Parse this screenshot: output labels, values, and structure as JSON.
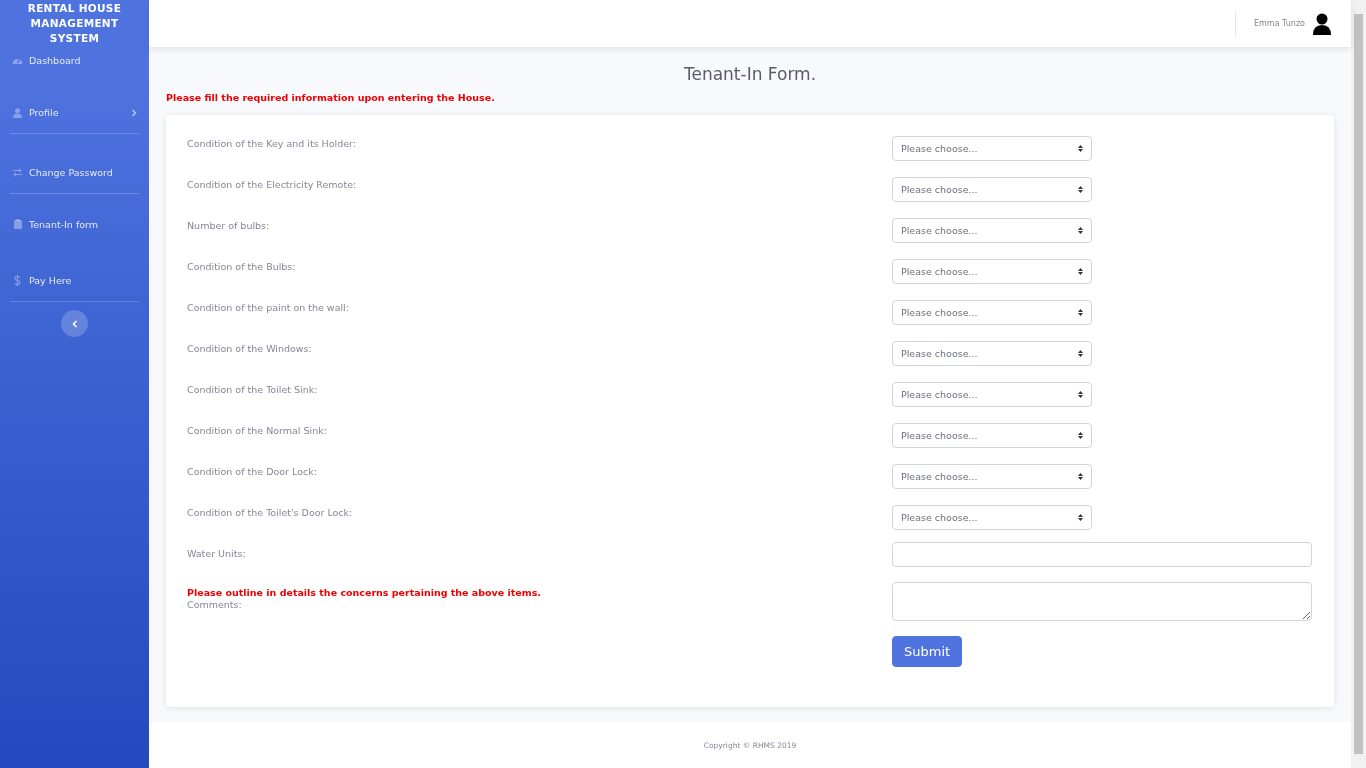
{
  "sidebar": {
    "brand": "RENTAL HOUSE MANAGEMENT SYSTEM",
    "items": [
      {
        "kind": "gauge",
        "label": "Dashboard",
        "expandable": false,
        "divider": false
      },
      {
        "kind": "user",
        "label": "Profile",
        "expandable": true,
        "divider": true
      },
      {
        "kind": "swap",
        "label": "Change Password",
        "expandable": false,
        "divider": true
      },
      {
        "kind": "clipboard",
        "label": "Tenant-In form",
        "expandable": false,
        "divider": false
      },
      {
        "kind": "dollar",
        "label": "Pay Here",
        "expandable": false,
        "divider": true
      }
    ]
  },
  "topbar": {
    "user_name": "Emma Tunzo"
  },
  "page": {
    "title": "Tenant-In Form.",
    "notice": "Please fill the required information upon entering the House."
  },
  "form": {
    "fields": [
      {
        "kind": "select",
        "label": "Condition of the Key and its Holder:",
        "placeholder": "Please choose..."
      },
      {
        "kind": "select",
        "label": "Condition of the Electricity Remote:",
        "placeholder": "Please choose..."
      },
      {
        "kind": "select",
        "label": "Number of bulbs:",
        "placeholder": "Please choose..."
      },
      {
        "kind": "select",
        "label": "Condition of the Bulbs:",
        "placeholder": "Please choose..."
      },
      {
        "kind": "select",
        "label": "Condition of the paint on the wall:",
        "placeholder": "Please choose..."
      },
      {
        "kind": "select",
        "label": "Condition of the Windows:",
        "placeholder": "Please choose..."
      },
      {
        "kind": "select",
        "label": "Condition of the Toilet Sink:",
        "placeholder": "Please choose..."
      },
      {
        "kind": "select",
        "label": "Condition of the Normal Sink:",
        "placeholder": "Please choose..."
      },
      {
        "kind": "select",
        "label": "Condition of the Door Lock:",
        "placeholder": "Please choose..."
      },
      {
        "kind": "select",
        "label": "Condition of the Toilet's Door Lock:",
        "placeholder": "Please choose..."
      },
      {
        "kind": "input",
        "label": "Water Units:"
      },
      {
        "kind": "textarea",
        "note": "Please outline in details the concerns pertaining the above items.",
        "label": "Comments:"
      }
    ],
    "submit": "Submit"
  },
  "footer": {
    "copyright": "Copyright © RHMS 2019"
  }
}
